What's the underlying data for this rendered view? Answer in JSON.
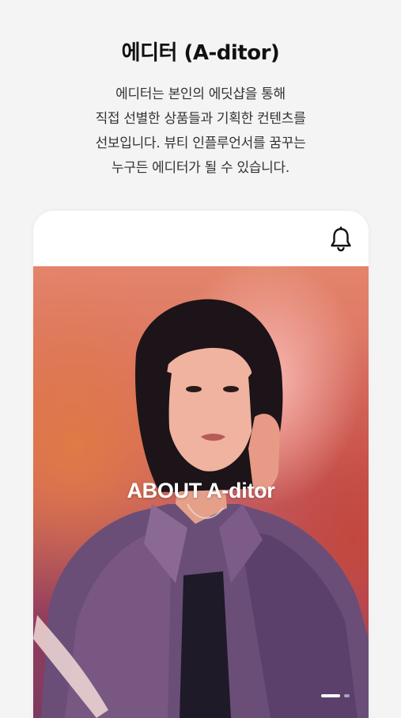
{
  "intro": {
    "title": "에디터 (A-ditor)",
    "description_lines": [
      "에디터는 본인의 에딧샵을 통해",
      "직접 선별한 상품들과 기획한 컨텐츠를",
      "선보입니다. 뷰티 인플루언서를 꿈꾸는",
      "누구든 에디터가 될 수 있습니다."
    ]
  },
  "app": {
    "header": {
      "notification_icon": "bell-icon"
    },
    "hero": {
      "title": "ABOUT A-ditor",
      "image": "portrait-photo",
      "pager": {
        "current": 1,
        "total": 2
      }
    }
  },
  "colors": {
    "background": "#f4f4f4",
    "text_primary": "#111111",
    "text_secondary": "#333333",
    "hero_text": "#ffffff"
  }
}
